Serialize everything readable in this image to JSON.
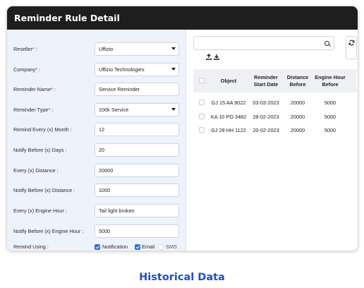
{
  "header": {
    "title": "Reminder Rule Detail"
  },
  "form": {
    "rows": [
      {
        "label": "Reseller",
        "required": true,
        "value": "Uffizio",
        "dropdown": true
      },
      {
        "label": "Company",
        "required": true,
        "value": "Uffizio Technologies",
        "dropdown": true
      },
      {
        "label": "Reminder Name",
        "required": true,
        "value": "Service Reminder",
        "dropdown": false
      },
      {
        "label": "Reminder Type",
        "required": true,
        "value": "100k Service",
        "dropdown": true
      },
      {
        "label": "Remind Every (x) Month :",
        "required": false,
        "value": "12",
        "dropdown": false
      },
      {
        "label": "Notify Before (x) Days :",
        "required": false,
        "value": "20",
        "dropdown": false
      },
      {
        "label": "Every (x) Distance :",
        "required": false,
        "value": "20000",
        "dropdown": false
      },
      {
        "label": "Notify Before (x) Distance :",
        "required": false,
        "value": "1000",
        "dropdown": false
      },
      {
        "label": "Every (x) Engine Hour :",
        "required": false,
        "value": "Tail light broken",
        "dropdown": false
      },
      {
        "label": "Notify Before (x) Engine Hour :",
        "required": false,
        "value": "5000",
        "dropdown": false
      }
    ],
    "req_mark": "*",
    "colon": " :",
    "remind_using": {
      "label": "Remind Using :",
      "options": [
        {
          "label": "Notification",
          "checked": true
        },
        {
          "label": "Email",
          "checked": true
        },
        {
          "label": "SMS",
          "checked": false
        }
      ]
    }
  },
  "table": {
    "search_placeholder": "",
    "columns": [
      {
        "key": "object",
        "label": "Object"
      },
      {
        "key": "start",
        "label": "Reminder Start Date"
      },
      {
        "key": "distance",
        "label": "Distance Before"
      },
      {
        "key": "engine",
        "label": "Engine Hour Before"
      }
    ],
    "rows": [
      {
        "object": "GJ 15 AA 9022",
        "start": "03-03-2023",
        "distance": "20000",
        "engine": "5000"
      },
      {
        "object": "KA 10 PO 3482",
        "start": "28-02-2023",
        "distance": "20000",
        "engine": "5000"
      },
      {
        "object": "GJ 28 HH 1122",
        "start": "20-02-2023",
        "distance": "20000",
        "engine": "5000"
      }
    ]
  },
  "footer": {
    "caption": "Historical Data"
  },
  "colors": {
    "header_bg": "#1e1e1e",
    "accent": "#2f6fdb",
    "caption": "#1b4fd0",
    "required": "#e0242a"
  }
}
